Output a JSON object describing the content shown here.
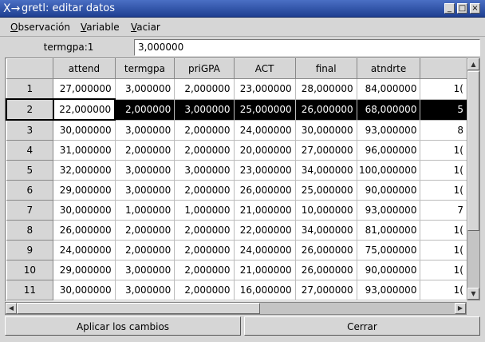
{
  "window": {
    "title": "gretl: editar datos",
    "icon": "x-logo-icon",
    "controls": [
      "_",
      "□",
      "×"
    ]
  },
  "menu": {
    "items": [
      {
        "label": "Observación",
        "underline": "O",
        "rest": "bservación"
      },
      {
        "label": "Variable",
        "underline": "V",
        "rest": "ariable"
      },
      {
        "label": "Vaciar",
        "underline": "V",
        "rest": "aciar"
      }
    ]
  },
  "cell_editor": {
    "label": "termgpa:1",
    "value": "3,000000"
  },
  "grid": {
    "columns": [
      "attend",
      "termgpa",
      "priGPA",
      "ACT",
      "final",
      "atndrte",
      ""
    ],
    "rows": [
      {
        "id": "1",
        "values": [
          "27,000000",
          "3,000000",
          "2,000000",
          "23,000000",
          "28,000000",
          "84,000000",
          "1("
        ]
      },
      {
        "id": "2",
        "values": [
          "22,000000",
          "2,000000",
          "3,000000",
          "25,000000",
          "26,000000",
          "68,000000",
          "5"
        ]
      },
      {
        "id": "3",
        "values": [
          "30,000000",
          "3,000000",
          "2,000000",
          "24,000000",
          "30,000000",
          "93,000000",
          "8"
        ]
      },
      {
        "id": "4",
        "values": [
          "31,000000",
          "2,000000",
          "2,000000",
          "20,000000",
          "27,000000",
          "96,000000",
          "1("
        ]
      },
      {
        "id": "5",
        "values": [
          "32,000000",
          "3,000000",
          "3,000000",
          "23,000000",
          "34,000000",
          "100,000000",
          "1("
        ]
      },
      {
        "id": "6",
        "values": [
          "29,000000",
          "3,000000",
          "2,000000",
          "26,000000",
          "25,000000",
          "90,000000",
          "1("
        ]
      },
      {
        "id": "7",
        "values": [
          "30,000000",
          "1,000000",
          "1,000000",
          "21,000000",
          "10,000000",
          "93,000000",
          "7"
        ]
      },
      {
        "id": "8",
        "values": [
          "26,000000",
          "2,000000",
          "2,000000",
          "22,000000",
          "34,000000",
          "81,000000",
          "1("
        ]
      },
      {
        "id": "9",
        "values": [
          "24,000000",
          "2,000000",
          "2,000000",
          "24,000000",
          "26,000000",
          "75,000000",
          "1("
        ]
      },
      {
        "id": "10",
        "values": [
          "29,000000",
          "3,000000",
          "2,000000",
          "21,000000",
          "26,000000",
          "90,000000",
          "1("
        ]
      },
      {
        "id": "11",
        "values": [
          "30,000000",
          "3,000000",
          "2,000000",
          "16,000000",
          "27,000000",
          "93,000000",
          "1("
        ]
      }
    ],
    "selected_row": 1
  },
  "buttons": {
    "apply": "Aplicar los cambios",
    "close": "Cerrar"
  }
}
